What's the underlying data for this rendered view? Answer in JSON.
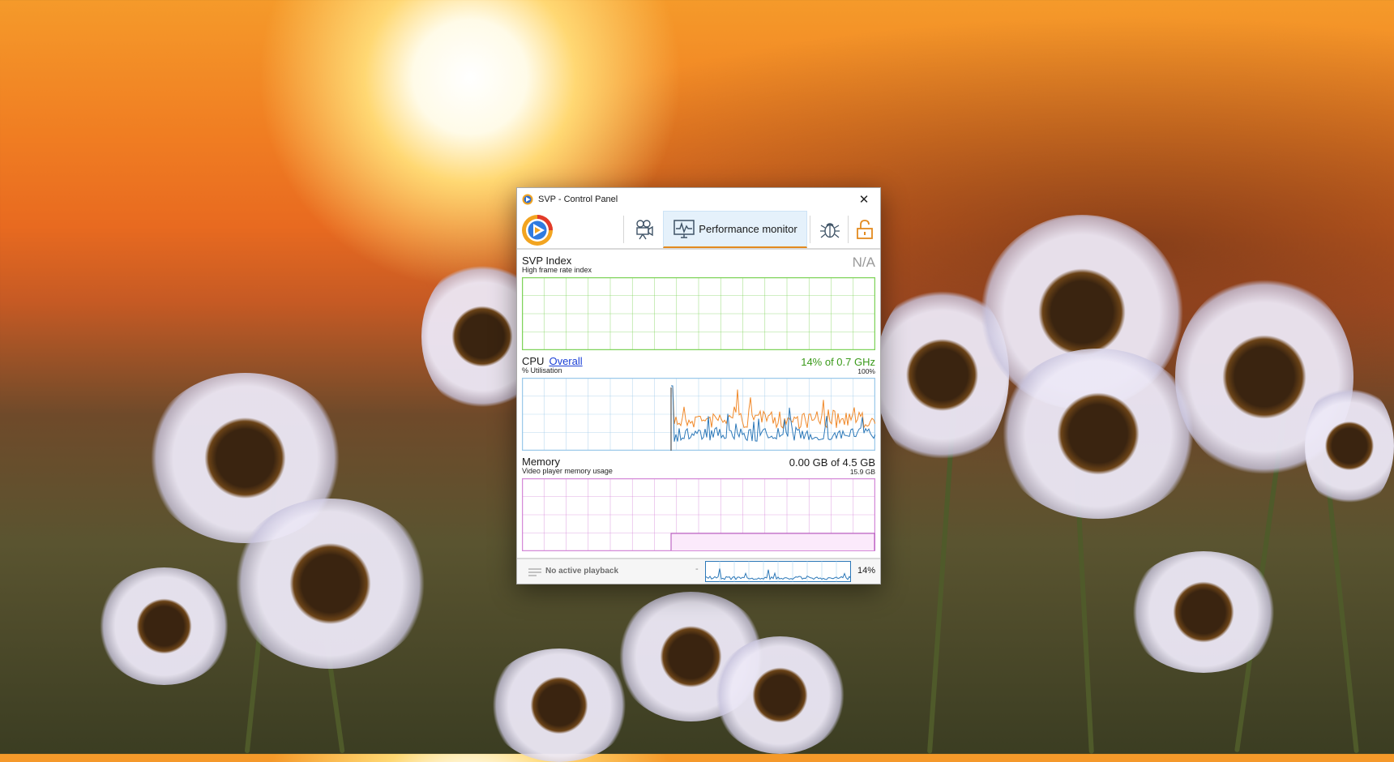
{
  "window": {
    "title": "SVP - Control Panel",
    "close_symbol": "✕"
  },
  "toolbar": {
    "active_tab_label": "Performance monitor",
    "icons": [
      "svp-logo-icon",
      "video-camera-icon",
      "monitor-chart-icon",
      "bug-icon",
      "unlock-icon"
    ]
  },
  "svp_index": {
    "title": "SVP Index",
    "subtitle": "High frame rate index",
    "value": "N/A",
    "grid_color": "#7fd35a"
  },
  "cpu": {
    "title": "CPU",
    "mode_link": "Overall",
    "subtitle": "% Utilisation",
    "value": "14% of 0.7 GHz",
    "value_color": "#3a9a1a",
    "scale_max": "100%",
    "grid_color": "#9cc9ea",
    "series_colors": [
      "#f0892a",
      "#2c78b8"
    ]
  },
  "memory": {
    "title": "Memory",
    "subtitle": "Video player memory usage",
    "value": "0.00 GB of 4.5 GB",
    "scale_max": "15.9 GB",
    "grid_color": "#d58ad8"
  },
  "status": {
    "text": "No active playback",
    "cpu_percent": "14%",
    "mini_dash": "-"
  }
}
